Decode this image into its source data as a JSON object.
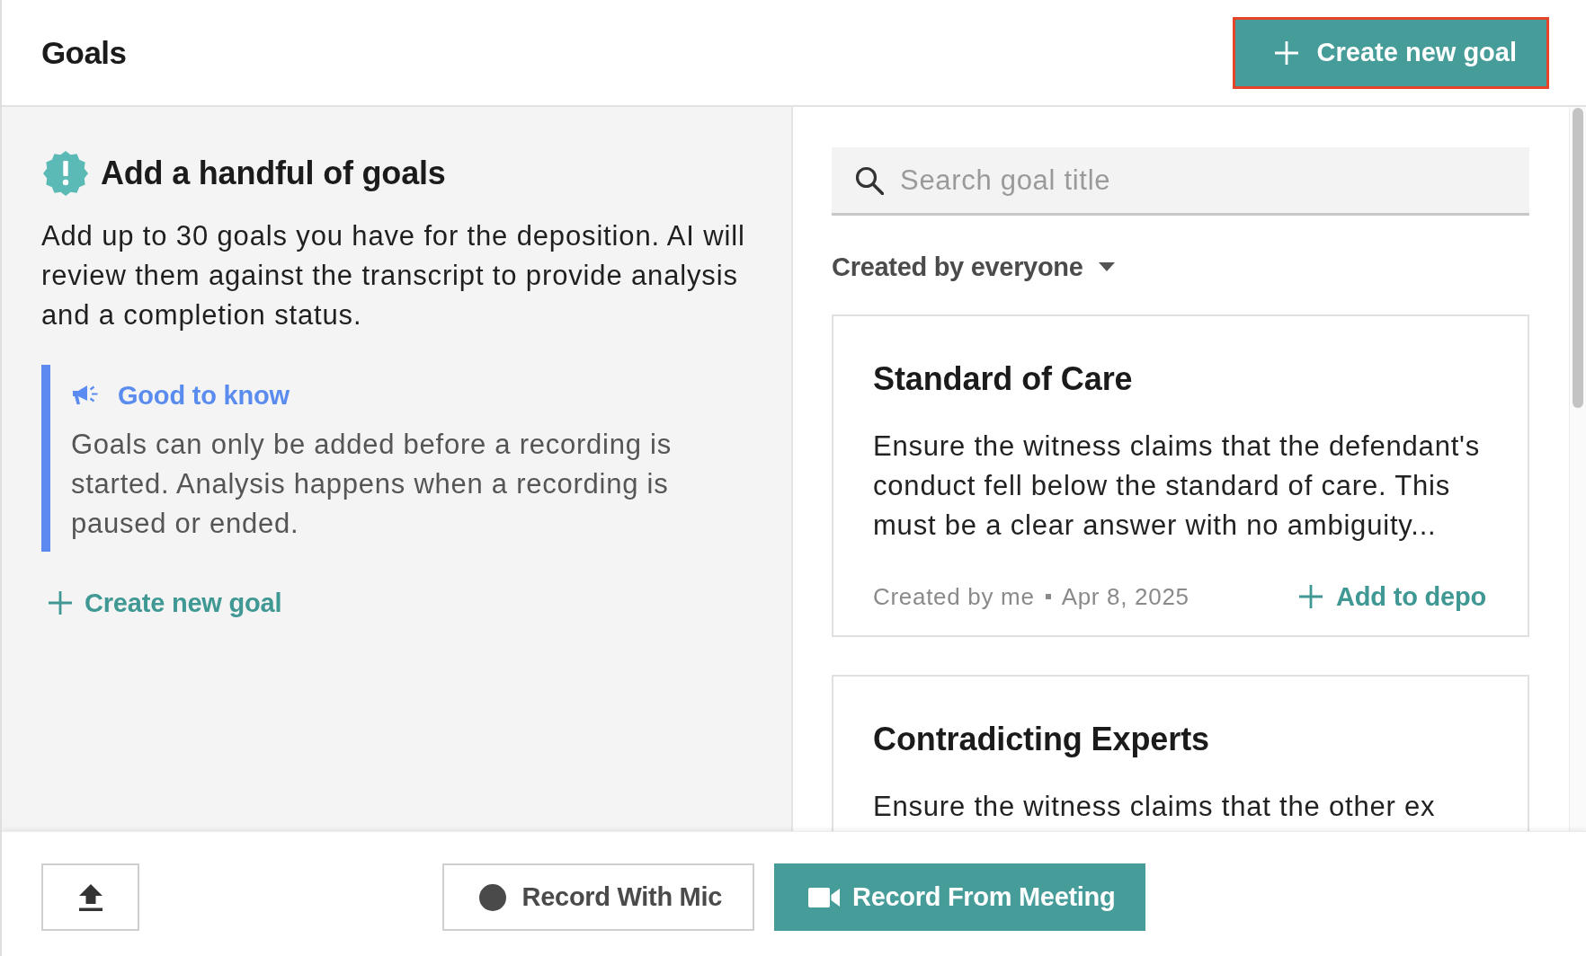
{
  "header": {
    "title": "Goals",
    "create_button": {
      "label": "Create new goal",
      "focused": true
    }
  },
  "intro": {
    "heading": "Add a handful of goals",
    "description": "Add up to 30 goals you have for the deposition. AI will review them against the transcript to provide analysis and a completion status.",
    "callout": {
      "title": "Good to know",
      "body": "Goals can only be added before a recording is started. Analysis happens when a recording is paused or ended."
    },
    "create_link": "Create new goal"
  },
  "goal_list": {
    "search": {
      "placeholder": "Search goal title"
    },
    "filter": {
      "label": "Created by everyone"
    },
    "goals": [
      {
        "title": "Standard of Care",
        "description": "Ensure the witness claims that the defendant's conduct fell below the standard of care. This must be a clear answer with no ambiguity...",
        "author": "Created by me",
        "date": "Apr 8, 2025",
        "action": "Add to depo"
      },
      {
        "title": "Contradicting Experts",
        "description": "Ensure the witness claims that the other ex"
      }
    ]
  },
  "footer": {
    "buttons": [
      {
        "kind": "upload"
      },
      {
        "kind": "mic",
        "label": "Record With Mic"
      },
      {
        "kind": "meeting",
        "label": "Record From Meeting"
      }
    ]
  }
}
